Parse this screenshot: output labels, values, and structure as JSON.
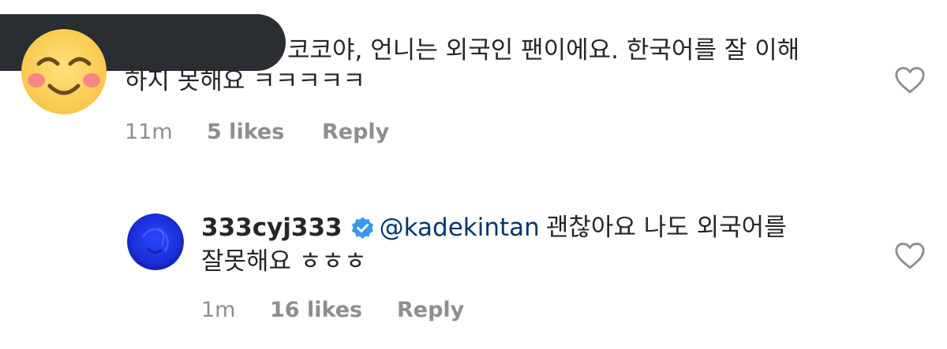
{
  "comment": {
    "avatar_icon": "smiling-face-emoji-icon",
    "text_line1": "코코야, 언니는 외국인 팬이에요. 한국어를 잘 이해",
    "text_line2": "하지 못해요 ㅋㅋㅋㅋㅋ",
    "time": "11m",
    "likes": "5 likes",
    "reply_label": "Reply",
    "like_icon": "heart-outline-icon"
  },
  "reply": {
    "username": "333cyj333",
    "verified_icon": "verified-badge-icon",
    "mention": "@kadekintan",
    "text_line1_rest": "괜찮아요 나도 외국어를",
    "text_line2": "잘못해요 ㅎㅎㅎ",
    "time": "1m",
    "likes": "16 likes",
    "reply_label": "Reply",
    "like_icon": "heart-outline-icon"
  },
  "colors": {
    "text": "#262626",
    "secondary": "#8e8e8e",
    "mention": "#00376b",
    "verified": "#3897f0",
    "redaction": "#2a2d31"
  }
}
